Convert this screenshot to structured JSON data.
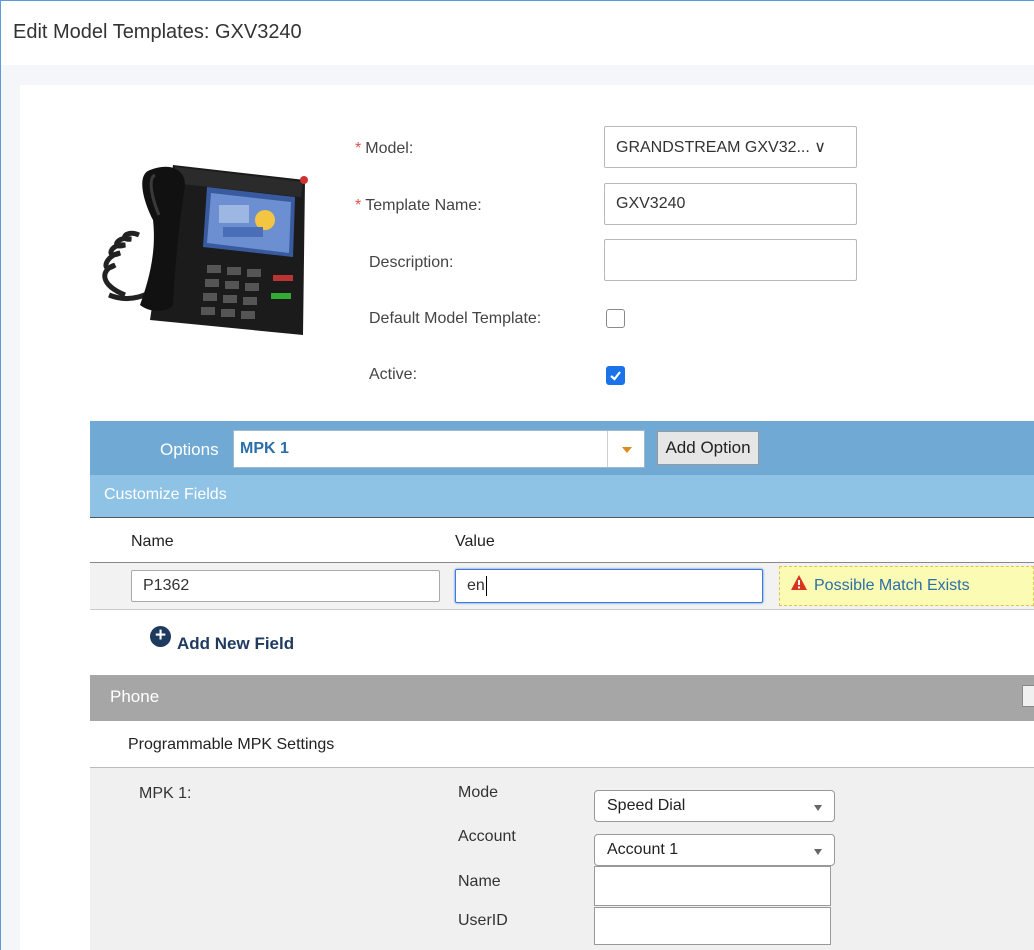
{
  "window": {
    "title": "Edit Model Templates: GXV3240"
  },
  "form": {
    "model_label": "Model:",
    "model_value": "GRANDSTREAM GXV32... ∨",
    "template_name_label": "Template Name:",
    "template_name_value": "GXV3240",
    "description_label": "Description:",
    "description_value": "",
    "default_label": "Default Model Template:",
    "default_checked": false,
    "active_label": "Active:",
    "active_checked": true,
    "required_mark": "*"
  },
  "options": {
    "label": "Options",
    "selected": "MPK 1",
    "add_button": "Add Option"
  },
  "customize": {
    "header": "Customize Fields",
    "col_name": "Name",
    "col_value": "Value",
    "rows": [
      {
        "name": "P1362",
        "value": "en",
        "warning": "Possible Match Exists"
      }
    ],
    "add_field": "Add New Field"
  },
  "phone_section": {
    "header": "Phone",
    "subheader": "Programmable MPK Settings",
    "mpk_label": "MPK 1:",
    "mode_label": "Mode",
    "mode_value": "Speed Dial",
    "account_label": "Account",
    "account_value": "Account 1",
    "name_label": "Name",
    "name_value": "",
    "userid_label": "UserID",
    "userid_value": ""
  },
  "colors": {
    "options_bar": "#6fa9d4",
    "customize_bar": "#8ec3e6",
    "phone_bar": "#a6a6a6",
    "warning_bg": "#fbfbb4",
    "link": "#2a6fa8",
    "checkbox_on": "#1a73e8"
  }
}
